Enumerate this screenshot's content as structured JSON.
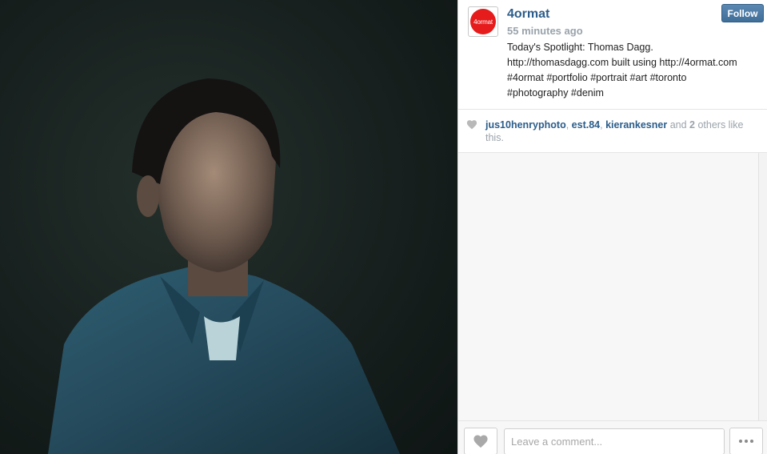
{
  "post": {
    "image_alt": "Portrait photograph of a man in a blue denim shirt against a dark green background",
    "icon": "portrait-photo"
  },
  "author": {
    "avatar_text": "4ormat",
    "avatar_color": "#e61b1b",
    "username": "4ormat",
    "timestamp": "55 minutes ago",
    "follow_label": "Follow"
  },
  "caption": {
    "lines": [
      "Today's Spotlight: Thomas Dagg.",
      "http://thomasdagg.com built using http://4ormat.com",
      "#4ormat #portfolio #portrait #art #toronto",
      "#photography #denim"
    ]
  },
  "likes": {
    "icon": "heart-icon",
    "users": [
      "jus10henryphoto",
      "est.84",
      "kierankesner"
    ],
    "separator": ", ",
    "and_text": " and ",
    "others_count": "2",
    "others_text": " others like this."
  },
  "comment_bar": {
    "like_icon": "heart-icon",
    "placeholder": "Leave a comment...",
    "more_icon": "ellipsis-icon"
  },
  "colors": {
    "link": "#2b5d8a",
    "muted": "#9aa3ab",
    "follow_bg": "#4a79a5"
  }
}
